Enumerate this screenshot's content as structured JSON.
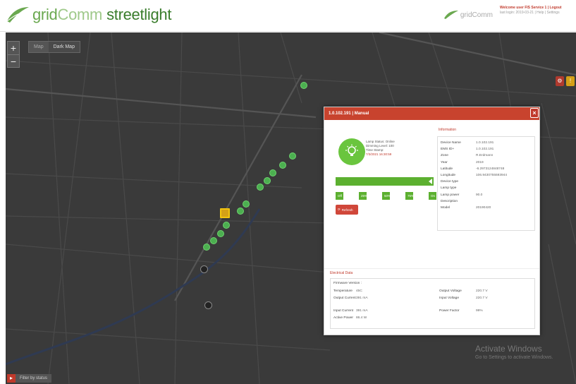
{
  "header": {
    "brand_grid": "grid",
    "brand_comm": "Comm",
    "brand_product": "streetlight",
    "small_logo_text": "gridComm",
    "user_line1": "Welcome user FIS Service 1 | Logout",
    "user_line2": "last login: 2019-03-21 | Help | Settings"
  },
  "map": {
    "zoom_in": "+",
    "zoom_out": "−",
    "type_options": [
      "Map",
      "Dark Map"
    ],
    "selected_type": "Dark Map",
    "bottom_left_label": "Filter by status",
    "activate_line1": "Activate Windows",
    "activate_line2": "Go to Settings to activate Windows."
  },
  "popup": {
    "title": "1.0.102.191 | Manual",
    "close": "×",
    "status_lines": [
      "Lamp Status: Online",
      "Dimming Level: 100",
      "Time Stamp:"
    ],
    "timestamp": "7/3/2021 16:30:59",
    "dim_levels": [
      "Off",
      "25%",
      "50%",
      "75%",
      "On"
    ],
    "refresh_label": "Refresh",
    "information_title": "Information",
    "information": [
      {
        "k": "Device Name",
        "v": "1.0.102.191"
      },
      {
        "k": "EMS ID+",
        "v": "1.0.102.191"
      },
      {
        "k": "Zone",
        "v": "R.Erdmann"
      },
      {
        "k": "Year",
        "v": "2019"
      },
      {
        "k": "Latitude",
        "v": "-6.2973124848748"
      },
      {
        "k": "Longitude",
        "v": "106.9430755593944"
      },
      {
        "k": "Device type",
        "v": ""
      },
      {
        "k": "Lamp type",
        "v": ""
      },
      {
        "k": "Lamp power",
        "v": "90.0"
      },
      {
        "k": "Description",
        "v": ""
      },
      {
        "k": "Model",
        "v": "20190420"
      }
    ],
    "electrical_title": "Electrical Data",
    "firmware_label": "Firmware Version :",
    "electrical_left": [
      {
        "k": "Temperature",
        "v": "45C"
      },
      {
        "k": "Output Current",
        "v": "391 mA"
      },
      {
        "k": "Input Current",
        "v": "391 mA"
      },
      {
        "k": "Active Power",
        "v": "86.4 W"
      }
    ],
    "electrical_right": [
      {
        "k": "Output Voltage",
        "v": "220.7 V"
      },
      {
        "k": "Input Voltage",
        "v": "220.7 V"
      },
      {
        "k": "Power Factor",
        "v": "99%"
      }
    ]
  }
}
